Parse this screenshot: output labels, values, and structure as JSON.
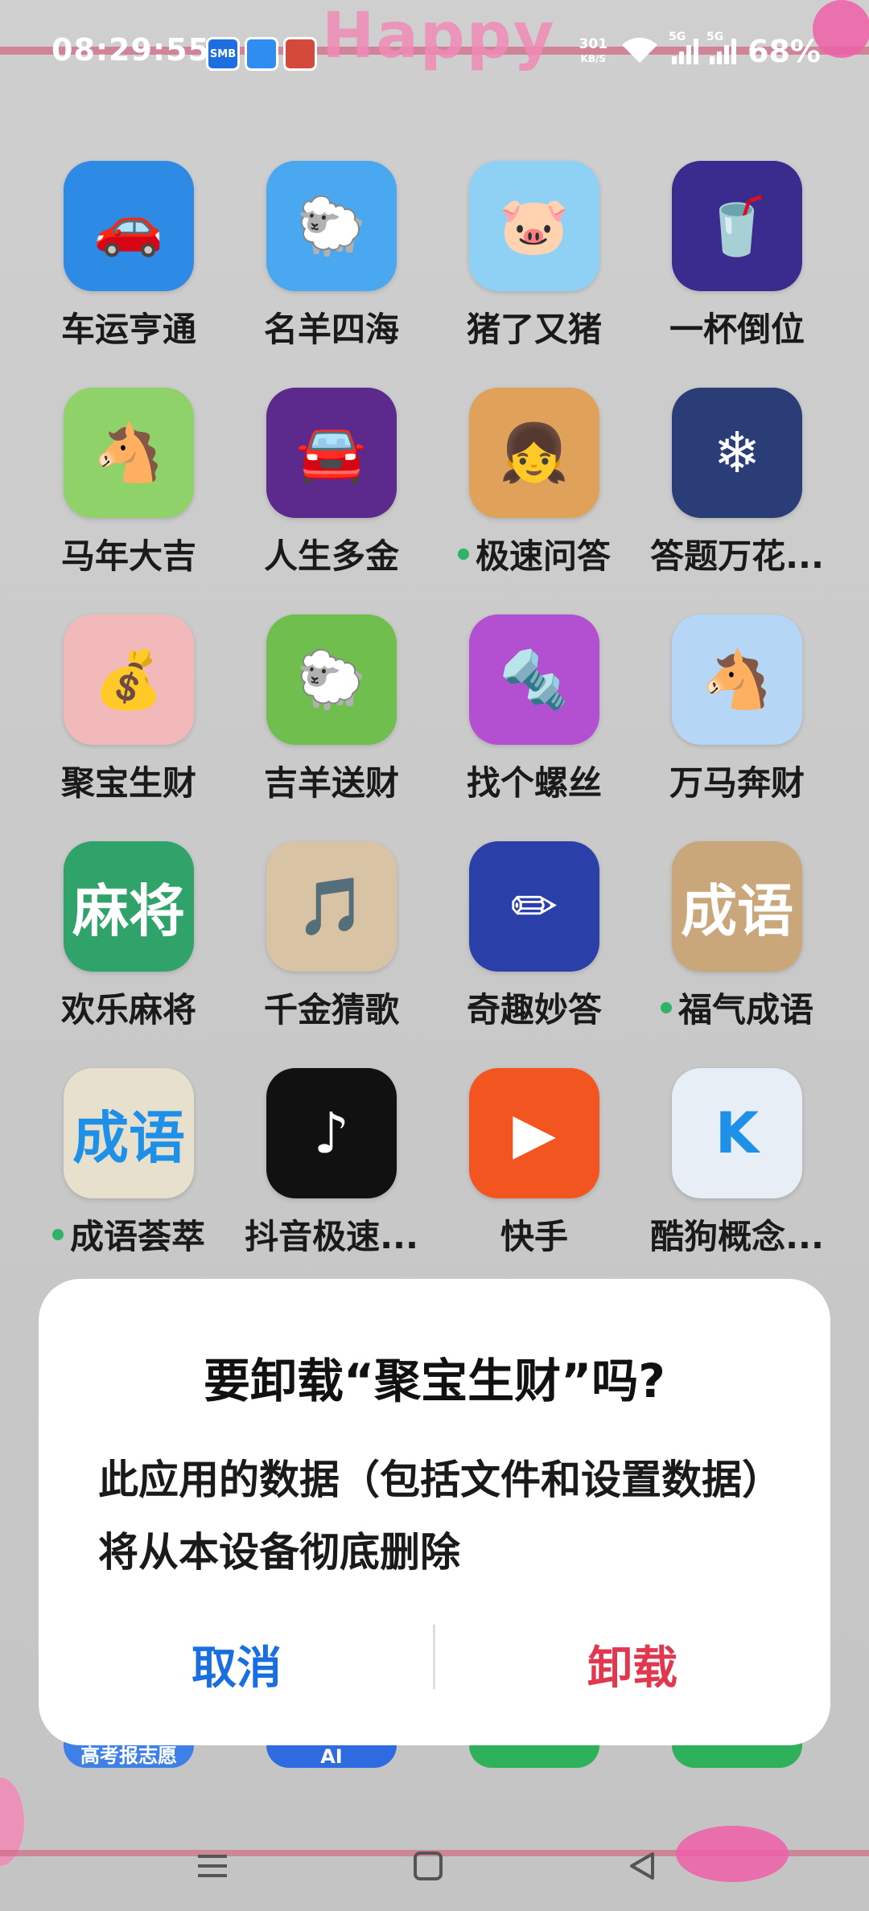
{
  "statusbar": {
    "time": "08:29:55",
    "notif_icons": [
      "SMB",
      "",
      ""
    ],
    "speed_value": "301",
    "speed_unit": "KB/S",
    "sim1": "5G",
    "sim2": "5G",
    "battery": "68%"
  },
  "wallpaper_text": "Happy",
  "apps": [
    {
      "label": "车运亨通",
      "dot": false,
      "color": "#2d8be6",
      "glyph": "🚗"
    },
    {
      "label": "名羊四海",
      "dot": false,
      "color": "#4aa8f0",
      "glyph": "🐑"
    },
    {
      "label": "猪了又猪",
      "dot": false,
      "color": "#8fd0f5",
      "glyph": "🐷"
    },
    {
      "label": "一杯倒位",
      "dot": false,
      "color": "#3a2b8f",
      "glyph": "🥤"
    },
    {
      "label": "马年大吉",
      "dot": false,
      "color": "#8fd26a",
      "glyph": "🐴"
    },
    {
      "label": "人生多金",
      "dot": false,
      "color": "#5b2a8c",
      "glyph": "🚘"
    },
    {
      "label": "极速问答",
      "dot": true,
      "color": "#e0a25a",
      "glyph": "👧"
    },
    {
      "label": "答题万花...",
      "dot": false,
      "color": "#2a3d77",
      "glyph": "❄"
    },
    {
      "label": "聚宝生财",
      "dot": false,
      "color": "#f1b9b9",
      "glyph": "💰"
    },
    {
      "label": "吉羊送财",
      "dot": false,
      "color": "#6fbe4e",
      "glyph": "🐑"
    },
    {
      "label": "找个螺丝",
      "dot": false,
      "color": "#b34fd1",
      "glyph": "🔩"
    },
    {
      "label": "万马奔财",
      "dot": false,
      "color": "#b5d6f5",
      "glyph": "🐴"
    },
    {
      "label": "欢乐麻将",
      "dot": false,
      "color": "#2fa36a",
      "glyph": "麻将"
    },
    {
      "label": "千金猜歌",
      "dot": false,
      "color": "#d9c3a5",
      "glyph": "🎵"
    },
    {
      "label": "奇趣妙答",
      "dot": false,
      "color": "#2b3fa8",
      "glyph": "✏"
    },
    {
      "label": "福气成语",
      "dot": true,
      "color": "#c9a77a",
      "glyph": "成语"
    },
    {
      "label": "成语荟萃",
      "dot": true,
      "color": "#e7e0cc",
      "glyph": "成语"
    },
    {
      "label": "抖音极速...",
      "dot": false,
      "color": "#111111",
      "glyph": "♪"
    },
    {
      "label": "快手",
      "dot": false,
      "color": "#f2551f",
      "glyph": "▶"
    },
    {
      "label": "酷狗概念...",
      "dot": false,
      "color": "#e8eef6",
      "glyph": "K"
    }
  ],
  "dock": [
    {
      "label": "高考报志愿",
      "color": "#3f7fe8"
    },
    {
      "label": "AI",
      "color": "#2f6be0"
    },
    {
      "label": "",
      "color": "#2fb05a"
    },
    {
      "label": "",
      "color": "#2fb05a"
    }
  ],
  "dialog": {
    "title": "要卸载“聚宝生财”吗?",
    "body": "此应用的数据（包括文件和设置数据）将从本设备彻底删除",
    "cancel": "取消",
    "confirm": "卸载"
  }
}
